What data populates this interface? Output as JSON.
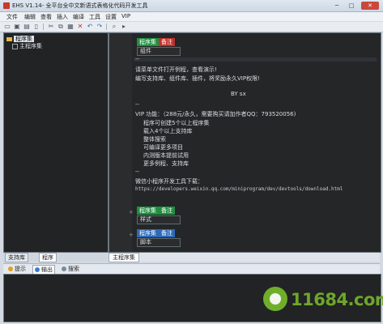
{
  "window": {
    "title": "EHS V1.14- 全平台全中文新语式表格化代码开发工具",
    "minimize": "─",
    "maximize": "□",
    "close": "✕"
  },
  "menu": [
    "文件",
    "编辑",
    "查看",
    "插入",
    "编译",
    "工具",
    "设置",
    "VIP"
  ],
  "toolbar_icons": [
    "folder-open",
    "save",
    "save-all",
    "cut",
    "copy",
    "paste",
    "delete",
    "undo",
    "redo",
    "find",
    "run",
    "tools"
  ],
  "project_tree": {
    "root": "程序集",
    "child": "主程序集"
  },
  "left_tabs": [
    "支持库",
    "程序"
  ],
  "editor": {
    "table1": {
      "h1": "程序集",
      "h2": "备注",
      "body": "组件"
    },
    "line_dash1": "--",
    "line1": "请菜单文件打开例程，查看演示!",
    "line2": "编写支持库、组件库、插件，将奖励永久VIP权限!",
    "line3": "BY sx",
    "line_dash2": "--",
    "vip_line": "VIP 功能：（288元/永久，需要购买请加作者QQ：793520056)",
    "vip_items": [
      "程序可创建5个以上程序集",
      "载入4个以上支持库",
      "整体搜索",
      "可编译更多项目",
      "内测版本提前试用",
      "更多例程、支持库"
    ],
    "line_dash3": "--",
    "mini_title": "微信小程序开发工具下载：",
    "mini_url": "https://developers.weixin.qq.com/miniprogram/dev/devtools/download.html",
    "table2": {
      "h1": "程序集",
      "h2": "备注",
      "body": "样式"
    },
    "table3": {
      "h1": "程序集",
      "h2": "备注",
      "body": "脚本"
    }
  },
  "editor_tab": "主程序集",
  "output_tabs": [
    "提示",
    "输出",
    "搜索"
  ],
  "watermark": "11684.com"
}
